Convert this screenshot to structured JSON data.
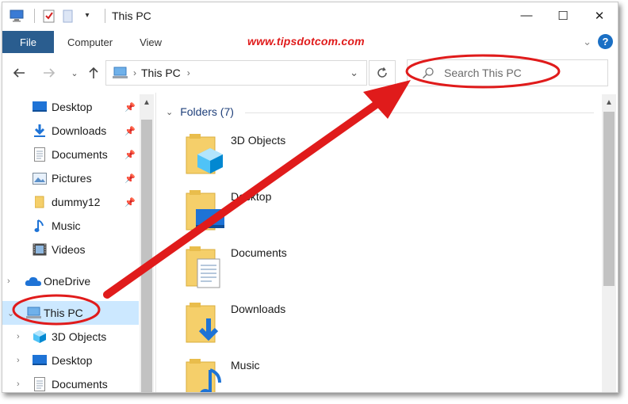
{
  "window": {
    "title": "This PC",
    "controls": {
      "minimize": "—",
      "maximize": "☐",
      "close": "✕"
    }
  },
  "ribbon": {
    "tabs": [
      "File",
      "Computer",
      "View"
    ],
    "brand": "www.tipsdotcom.com",
    "help": "?"
  },
  "address": {
    "path": "This PC",
    "search_placeholder": "Search This PC"
  },
  "nav_pane": {
    "quick_access": [
      {
        "label": "Desktop",
        "icon": "desktop-icon",
        "pinned": true
      },
      {
        "label": "Downloads",
        "icon": "downloads-icon",
        "pinned": true
      },
      {
        "label": "Documents",
        "icon": "documents-icon",
        "pinned": true
      },
      {
        "label": "Pictures",
        "icon": "pictures-icon",
        "pinned": true
      },
      {
        "label": "dummy12",
        "icon": "folder-icon",
        "pinned": true
      },
      {
        "label": "Music",
        "icon": "music-icon",
        "pinned": false
      },
      {
        "label": "Videos",
        "icon": "videos-icon",
        "pinned": false
      }
    ],
    "onedrive": "OneDrive",
    "this_pc": "This PC",
    "this_pc_children": [
      "3D Objects",
      "Desktop",
      "Documents"
    ]
  },
  "content": {
    "group_header": "Folders (7)",
    "folders": [
      "3D Objects",
      "Desktop",
      "Documents",
      "Downloads",
      "Music"
    ]
  },
  "colors": {
    "accent": "#2a5d8f",
    "selection": "#cce8ff",
    "annotation": "#e01b1b",
    "folder": "#f5cf6a"
  }
}
